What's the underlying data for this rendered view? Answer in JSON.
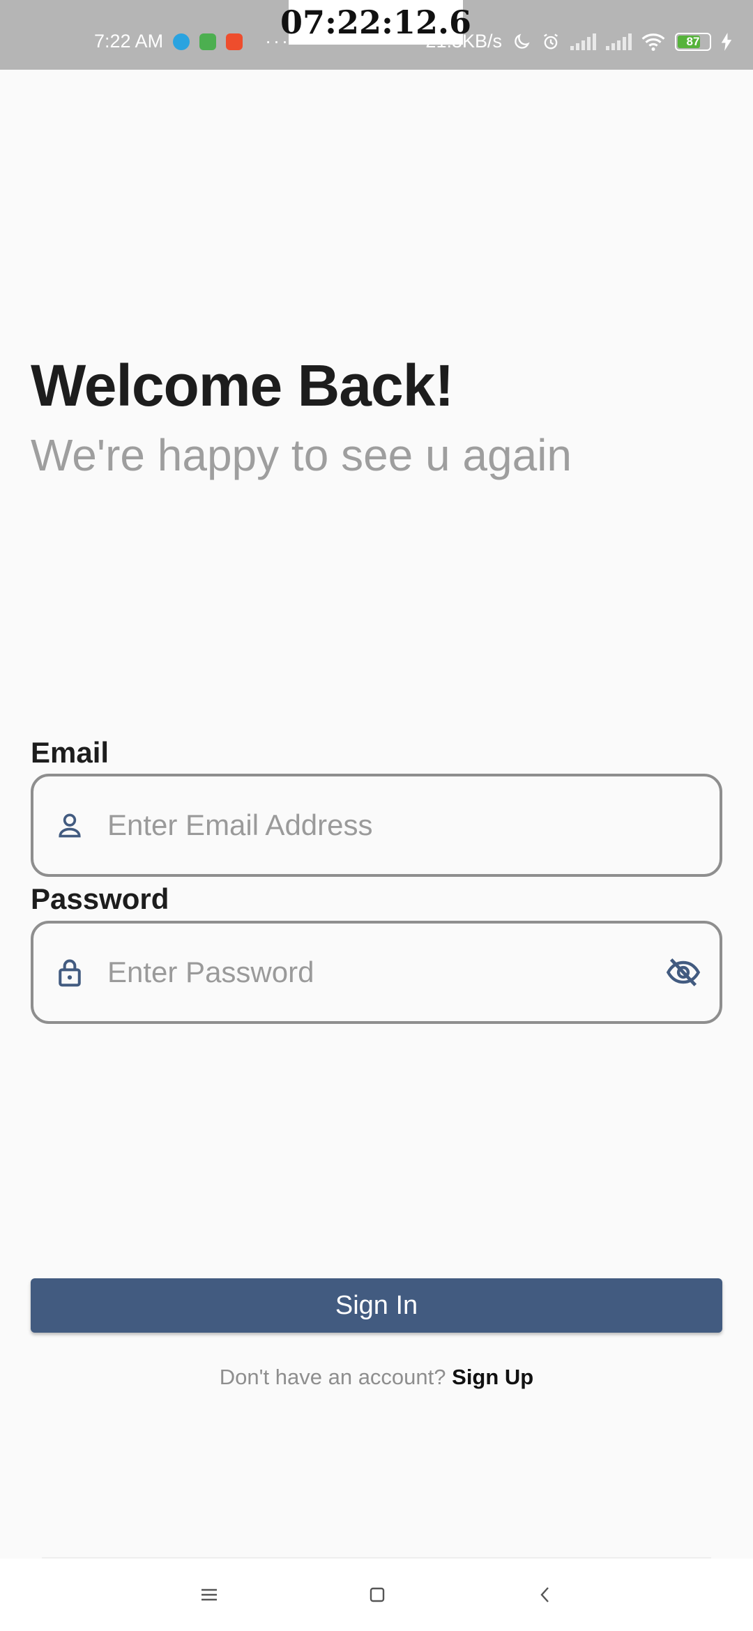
{
  "status_bar": {
    "time": "7:22 AM",
    "overlay_timer": "07:22:12.6",
    "net_speed": "21.3KB/s",
    "battery": "87",
    "dots": "···"
  },
  "header": {
    "title": "Welcome Back!",
    "subtitle": "We're happy to see u again"
  },
  "form": {
    "email_label": "Email",
    "email_placeholder": "Enter Email Address",
    "email_value": "",
    "password_label": "Password",
    "password_placeholder": "Enter Password",
    "password_value": ""
  },
  "actions": {
    "signin_label": "Sign In",
    "signup_prompt": "Don't have an account?",
    "signup_link": "Sign Up"
  },
  "icons": {
    "email_field_icon": "person-icon",
    "password_field_icon": "lock-icon",
    "password_toggle_icon": "eye-off-icon"
  },
  "colors": {
    "primary": "#425b80",
    "title_text": "#1d1d1d",
    "subtitle_text": "#9e9e9e",
    "field_border": "#8e8e8e",
    "background": "#fafafa"
  }
}
